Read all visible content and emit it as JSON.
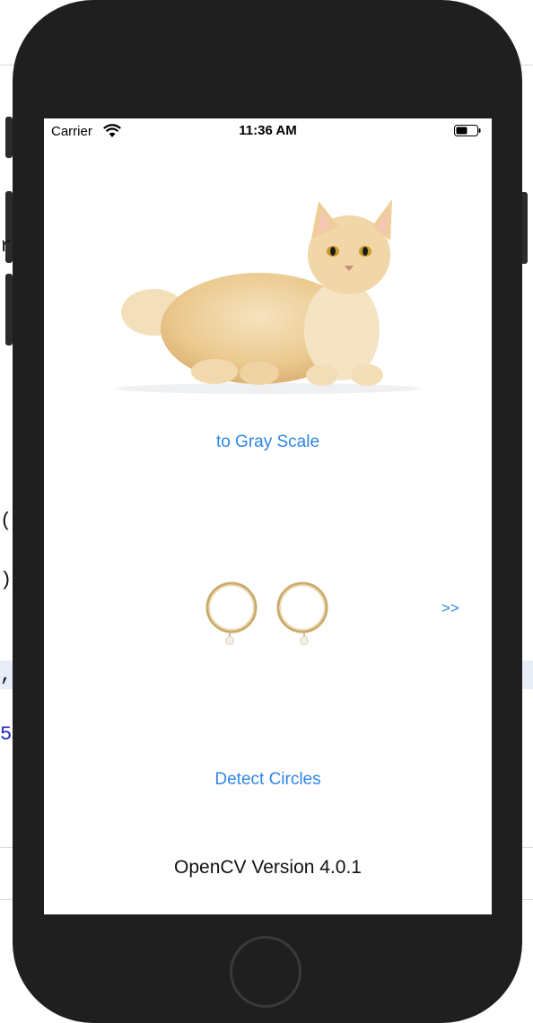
{
  "status_bar": {
    "carrier": "Carrier",
    "time": "11:36 AM",
    "wifi_icon": "wifi-icon",
    "battery_icon": "battery-icon"
  },
  "app": {
    "gray_scale_button": "to Gray Scale",
    "next_button": ">>",
    "detect_circles_button": "Detect Circles",
    "version_label": "OpenCV Version 4.0.1"
  },
  "colors": {
    "link": "#2f86e6",
    "device_frame": "#1f1f1f",
    "screen_background": "#ffffff"
  }
}
